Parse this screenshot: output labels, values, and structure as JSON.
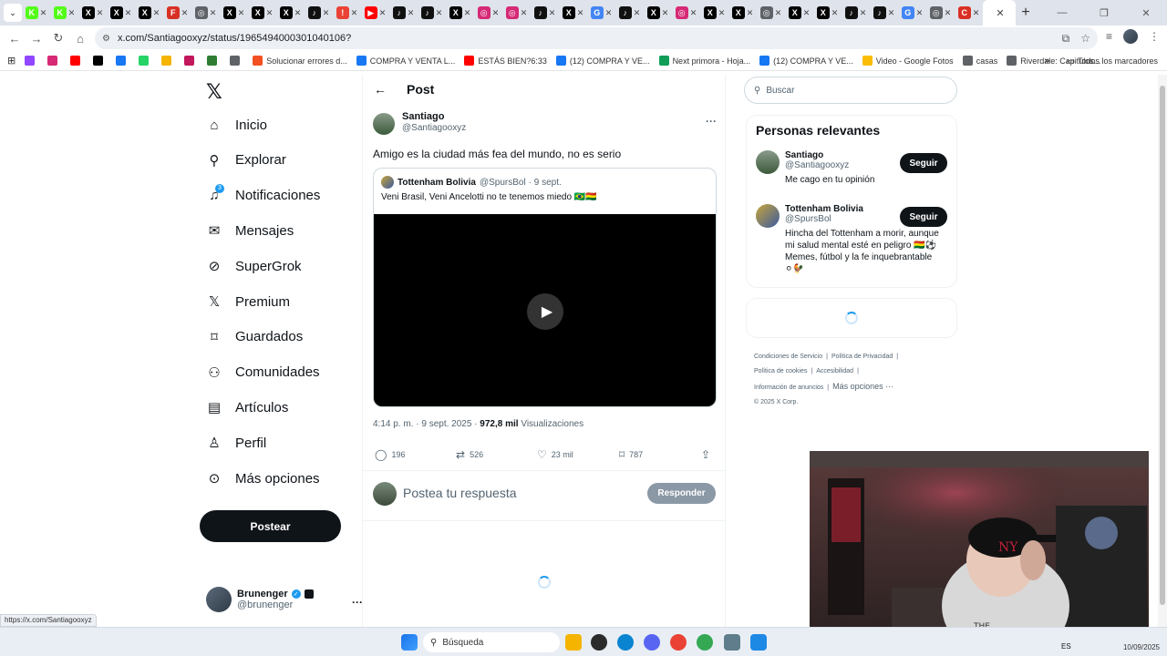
{
  "browser": {
    "tabs": [
      {
        "icon": "kick",
        "color": "#53fc18",
        "letter": "K"
      },
      {
        "icon": "kick",
        "color": "#53fc18",
        "letter": "K"
      },
      {
        "icon": "x",
        "color": "#000000",
        "letter": "X"
      },
      {
        "icon": "x",
        "color": "#000000",
        "letter": "X"
      },
      {
        "icon": "x",
        "color": "#000000",
        "letter": "X"
      },
      {
        "icon": "f",
        "color": "#d93025",
        "letter": "F"
      },
      {
        "icon": "web",
        "color": "#5f6368",
        "letter": "◎"
      },
      {
        "icon": "x",
        "color": "#000000",
        "letter": "X"
      },
      {
        "icon": "x",
        "color": "#000000",
        "letter": "X"
      },
      {
        "icon": "x",
        "color": "#000000",
        "letter": "X"
      },
      {
        "icon": "tiktok",
        "color": "#111111",
        "letter": "♪"
      },
      {
        "icon": "alert",
        "color": "#ea4335",
        "letter": "!"
      },
      {
        "icon": "youtube",
        "color": "#ff0000",
        "letter": "▶"
      },
      {
        "icon": "tiktok",
        "color": "#111111",
        "letter": "♪"
      },
      {
        "icon": "tiktok",
        "color": "#111111",
        "letter": "♪"
      },
      {
        "icon": "x",
        "color": "#000000",
        "letter": "X"
      },
      {
        "icon": "instagram",
        "color": "#d62976",
        "letter": "◎"
      },
      {
        "icon": "instagram",
        "color": "#d62976",
        "letter": "◎"
      },
      {
        "icon": "tiktok",
        "color": "#111111",
        "letter": "♪"
      },
      {
        "icon": "x",
        "color": "#000000",
        "letter": "X"
      },
      {
        "icon": "google",
        "color": "#4285f4",
        "letter": "G"
      },
      {
        "icon": "tiktok",
        "color": "#111111",
        "letter": "♪"
      },
      {
        "icon": "x",
        "color": "#000000",
        "letter": "X"
      },
      {
        "icon": "instagram",
        "color": "#d62976",
        "letter": "◎"
      },
      {
        "icon": "x",
        "color": "#000000",
        "letter": "X"
      },
      {
        "icon": "x",
        "color": "#000000",
        "letter": "X"
      },
      {
        "icon": "web",
        "color": "#5f6368",
        "letter": "◎"
      },
      {
        "icon": "x",
        "color": "#000000",
        "letter": "X"
      },
      {
        "icon": "x",
        "color": "#000000",
        "letter": "X"
      },
      {
        "icon": "tiktok",
        "color": "#111111",
        "letter": "♪"
      },
      {
        "icon": "tiktok",
        "color": "#111111",
        "letter": "♪"
      },
      {
        "icon": "google",
        "color": "#4285f4",
        "letter": "G"
      },
      {
        "icon": "web",
        "color": "#5f6368",
        "letter": "◎"
      },
      {
        "icon": "pdf",
        "color": "#d93025",
        "letter": "C"
      }
    ],
    "url": "x.com/Santiagooxyz/status/1965494000301040106?",
    "status_url": "https://x.com/Santiagooxyz",
    "bookmarks": [
      {
        "label": "",
        "color": "#9146ff"
      },
      {
        "label": "",
        "color": "#d62976"
      },
      {
        "label": "",
        "color": "#ff0000"
      },
      {
        "label": "",
        "color": "#000000"
      },
      {
        "label": "",
        "color": "#1877f2"
      },
      {
        "label": "",
        "color": "#25d366"
      },
      {
        "label": "",
        "color": "#f4b400"
      },
      {
        "label": "",
        "color": "#c2185b"
      },
      {
        "label": "",
        "color": "#2e7d32"
      },
      {
        "label": "",
        "color": "#5f6368"
      },
      {
        "label": "Solucionar errores d...",
        "color": "#f25022"
      },
      {
        "label": "COMPRA Y VENTA L...",
        "color": "#1877f2"
      },
      {
        "label": "ESTÁS BIEN?6:33",
        "color": "#ff0000"
      },
      {
        "label": "(12) COMPRA Y VE...",
        "color": "#1877f2"
      },
      {
        "label": "Next primora - Hoja...",
        "color": "#0f9d58"
      },
      {
        "label": "(12) COMPRA Y VE...",
        "color": "#1877f2"
      },
      {
        "label": "Video - Google Fotos",
        "color": "#fbbc05"
      },
      {
        "label": "casas",
        "color": "#5f6368"
      },
      {
        "label": "Riverdale: Capitulos...",
        "color": "#5f6368"
      }
    ],
    "all_bookmarks": "Todos los marcadores"
  },
  "sidebar": {
    "items": [
      {
        "label": "Inicio",
        "icon": "home-icon"
      },
      {
        "label": "Explorar",
        "icon": "search-icon"
      },
      {
        "label": "Notificaciones",
        "icon": "bell-icon",
        "badge": "3"
      },
      {
        "label": "Mensajes",
        "icon": "mail-icon"
      },
      {
        "label": "SuperGrok",
        "icon": "grok-icon"
      },
      {
        "label": "Premium",
        "icon": "x-premium-icon"
      },
      {
        "label": "Guardados",
        "icon": "bookmark-icon"
      },
      {
        "label": "Comunidades",
        "icon": "people-icon"
      },
      {
        "label": "Artículos",
        "icon": "article-icon"
      },
      {
        "label": "Perfil",
        "icon": "person-icon"
      },
      {
        "label": "Más opciones",
        "icon": "more-circle-icon"
      }
    ],
    "post_button": "Postear",
    "account": {
      "name": "Brunenger",
      "handle": "@brunenger"
    }
  },
  "post": {
    "header": "Post",
    "author": {
      "name": "Santiago",
      "handle": "@Santiagooxyz"
    },
    "text": "Amigo es la ciudad más fea del mundo, no es serio",
    "quote": {
      "name": "Tottenham Bolivia",
      "handle": "@SpursBol",
      "date": "· 9 sept.",
      "text": "Veni Brasil, Veni Ancelotti no te tenemos miedo 🇧🇷🇧🇴"
    },
    "time": "4:14 p. m. · 9 sept. 2025 · ",
    "views": "972,8 mil",
    "views_label": " Visualizaciones",
    "stats": {
      "replies": "196",
      "reposts": "526",
      "likes": "23 mil",
      "bookmarks": "787"
    },
    "reply_placeholder": "Postea tu respuesta",
    "reply_button": "Responder"
  },
  "right": {
    "search_placeholder": "Buscar",
    "relevant_title": "Personas relevantes",
    "users": [
      {
        "name": "Santiago",
        "handle": "@Santiagooxyz",
        "bio": "Me cago en tu opinión",
        "follow": "Seguir"
      },
      {
        "name": "Tottenham Bolivia",
        "handle": "@SpursBol",
        "bio": "Hincha del Tottenham a morir, aunque mi salud mental esté en peligro 🇧🇴⚽ Memes, fútbol y la fe inquebrantable ⚪🐓",
        "follow": "Seguir"
      }
    ],
    "footer": [
      "Condiciones de Servicio",
      "|",
      "Política de Privacidad",
      "|",
      "Política de cookies",
      "|",
      "Accesibilidad",
      "|",
      "Información de anuncios",
      "|",
      "Más opciones ···",
      "© 2025 X Corp."
    ]
  },
  "taskbar": {
    "search": "Búsqueda",
    "lang": "ES",
    "date": "10/09/2025"
  }
}
